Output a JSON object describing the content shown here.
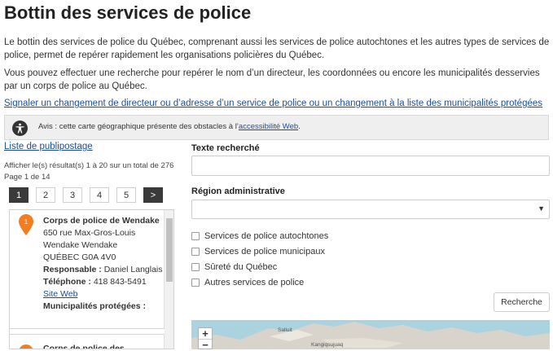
{
  "page": {
    "title": "Bottin des services de police",
    "intro1": "Le bottin des services de police du Québec, comprenant aussi les services de police autochtones et les autres types de services de police, permet de repérer rapidement les organisations policières du Québec.",
    "intro2": "Vous pouvez effectuer une recherche pour repérer le nom d’un directeur, les coordonnées ou encore les municipalités desservies par un corps de police au Québec.",
    "signal_link": "Signaler un changement de directeur ou d’adresse d’un service de police ou un changement à la liste des municipalités protégées"
  },
  "notice": {
    "icon": "accessibility-icon",
    "prefix": "Avis : cette carte géographique présente des obstacles à l’",
    "link": "accessibilité Web",
    "suffix": "."
  },
  "list": {
    "mail_link": "Liste de publipostage",
    "results_text": "Afficher le(s) résultat(s) 1 à 20 sur un total de 276",
    "page_text": "Page 1 de 14",
    "pages": [
      "1",
      "2",
      "3",
      "4",
      "5"
    ],
    "next": ">",
    "cards": [
      {
        "marker": "1",
        "name": "Corps de police de Wendake",
        "address1": "650 rue Max-Gros-Louis",
        "address2": "Wendake Wendake",
        "address3": "QUÉBEC G0A 4V0",
        "responsable_label": "Responsable :",
        "responsable": "Daniel Langlais",
        "tel_label": "Téléphone :",
        "tel": "418 843-5491",
        "site": "Site Web",
        "munis_label": "Municipalités protégées :"
      },
      {
        "marker": "2",
        "name": "Corps de police des"
      }
    ]
  },
  "search": {
    "text_label": "Texte recherché",
    "text_value": "",
    "region_label": "Région administrative",
    "region_value": "",
    "checkboxes": [
      "Services de police autochtones",
      "Services de police municipaux",
      "Sûreté du Québec",
      "Autres services de police"
    ],
    "button": "Recherche"
  },
  "map": {
    "zoom_in": "+",
    "zoom_out": "−",
    "labels": [
      "Salluit",
      "Kangiqsujuaq"
    ]
  },
  "colors": {
    "link": "#1a4e9c",
    "pin": "#f57c1f",
    "active_page": "#3a3a3a",
    "map_water": "#aad3df"
  }
}
